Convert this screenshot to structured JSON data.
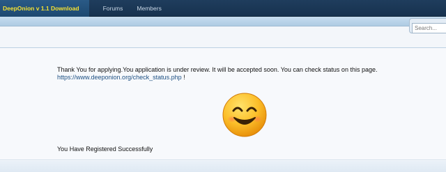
{
  "nav": {
    "active_tab": "DeepOnion v 1.1 Download",
    "links": [
      "Forums",
      "Members"
    ]
  },
  "search": {
    "placeholder": "Search..."
  },
  "content": {
    "message": "Thank You for applying.You application is under review. It will be accepted soon. You can check status on this page.",
    "status_link": "https://www.deeponion.org/check_status.php",
    "status_link_suffix": "!",
    "success_text": "You Have Registered Successfully"
  },
  "icons": {
    "smiley": "smiling-face-icon"
  },
  "colors": {
    "nav_bg": "#1f3d5d",
    "active_tab_text": "#f5e233",
    "link": "#1c4f82",
    "band": "#aecbe3"
  }
}
